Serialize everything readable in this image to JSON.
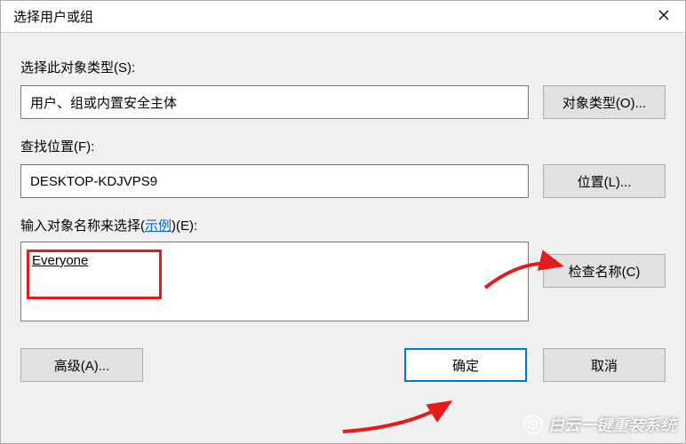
{
  "window": {
    "title": "选择用户或组"
  },
  "objectType": {
    "label": "选择此对象类型(S):",
    "value": "用户、组或内置安全主体",
    "button": "对象类型(O)..."
  },
  "location": {
    "label": "查找位置(F):",
    "value": "DESKTOP-KDJVPS9",
    "button": "位置(L)..."
  },
  "names": {
    "label_prefix": "输入对象名称来选择(",
    "label_link": "示例",
    "label_suffix": ")(E):",
    "entered": "Everyone",
    "check_button": "检查名称(C)"
  },
  "buttons": {
    "advanced": "高级(A)...",
    "ok": "确定",
    "cancel": "取消"
  },
  "watermark": "白云一键重装系统"
}
